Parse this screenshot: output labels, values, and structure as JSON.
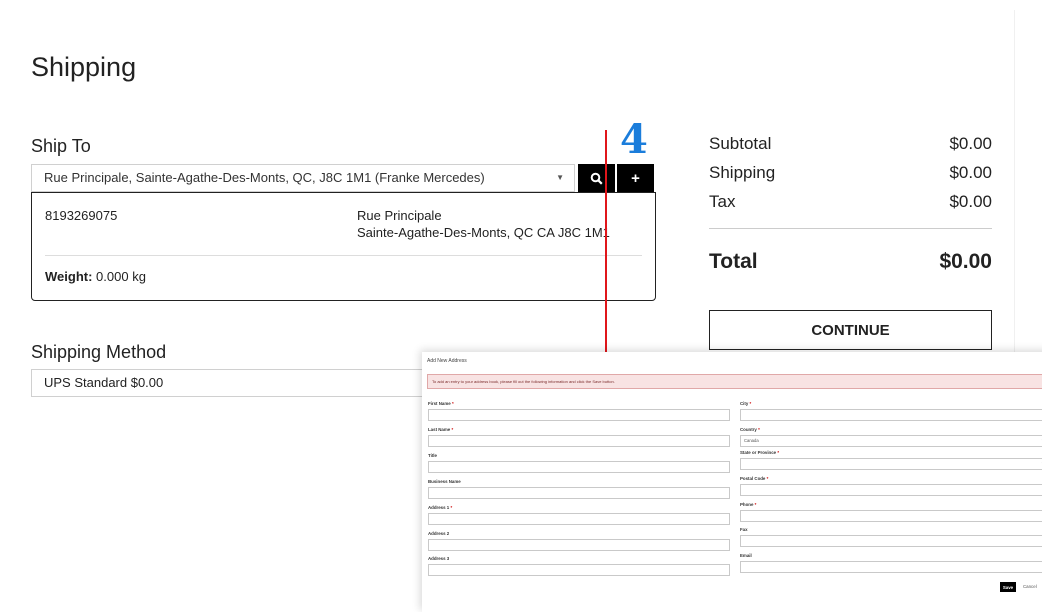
{
  "page": {
    "title": "Shipping"
  },
  "ship_to": {
    "label": "Ship To",
    "selected_address": "Rue Principale, Sainte-Agathe-Des-Monts, QC, J8C 1M1 (Franke Mercedes)",
    "phone": "8193269075",
    "street": "Rue Principale",
    "city_line": "Sainte-Agathe-Des-Monts, QC CA J8C 1M1",
    "weight_label": "Weight:",
    "weight_value": "0.000 kg",
    "search_icon_glyph": "🔍",
    "add_icon_glyph": "+"
  },
  "shipping_method": {
    "label": "Shipping Method",
    "value": "UPS Standard $0.00"
  },
  "summary": {
    "subtotal_label": "Subtotal",
    "subtotal_value": "$0.00",
    "shipping_label": "Shipping",
    "shipping_value": "$0.00",
    "tax_label": "Tax",
    "tax_value": "$0.00",
    "total_label": "Total",
    "total_value": "$0.00",
    "continue_label": "CONTINUE"
  },
  "annotation": {
    "number": "4",
    "color": "#1b7ddb",
    "line_color": "#e0161b"
  },
  "dialog": {
    "title": "Add New Address",
    "notice": "To add an entry to your address book, please fill out the following information and click the Save button.",
    "left_fields": [
      {
        "label": "First Name",
        "required": true
      },
      {
        "label": "Last Name",
        "required": true
      },
      {
        "label": "Title",
        "required": false
      },
      {
        "label": "Business Name",
        "required": false
      },
      {
        "label": "Address 1",
        "required": true
      },
      {
        "label": "Address 2",
        "required": false
      },
      {
        "label": "Address 3",
        "required": false
      }
    ],
    "city_label": "City",
    "country_label": "Country",
    "country_value": "Canada",
    "state_label": "State or Province",
    "postal_label": "Postal Code",
    "phone_label": "Phone",
    "fax_label": "Fax",
    "email_label": "Email",
    "required_mark": "*",
    "save_label": "Save",
    "cancel_label": "Cancel"
  }
}
